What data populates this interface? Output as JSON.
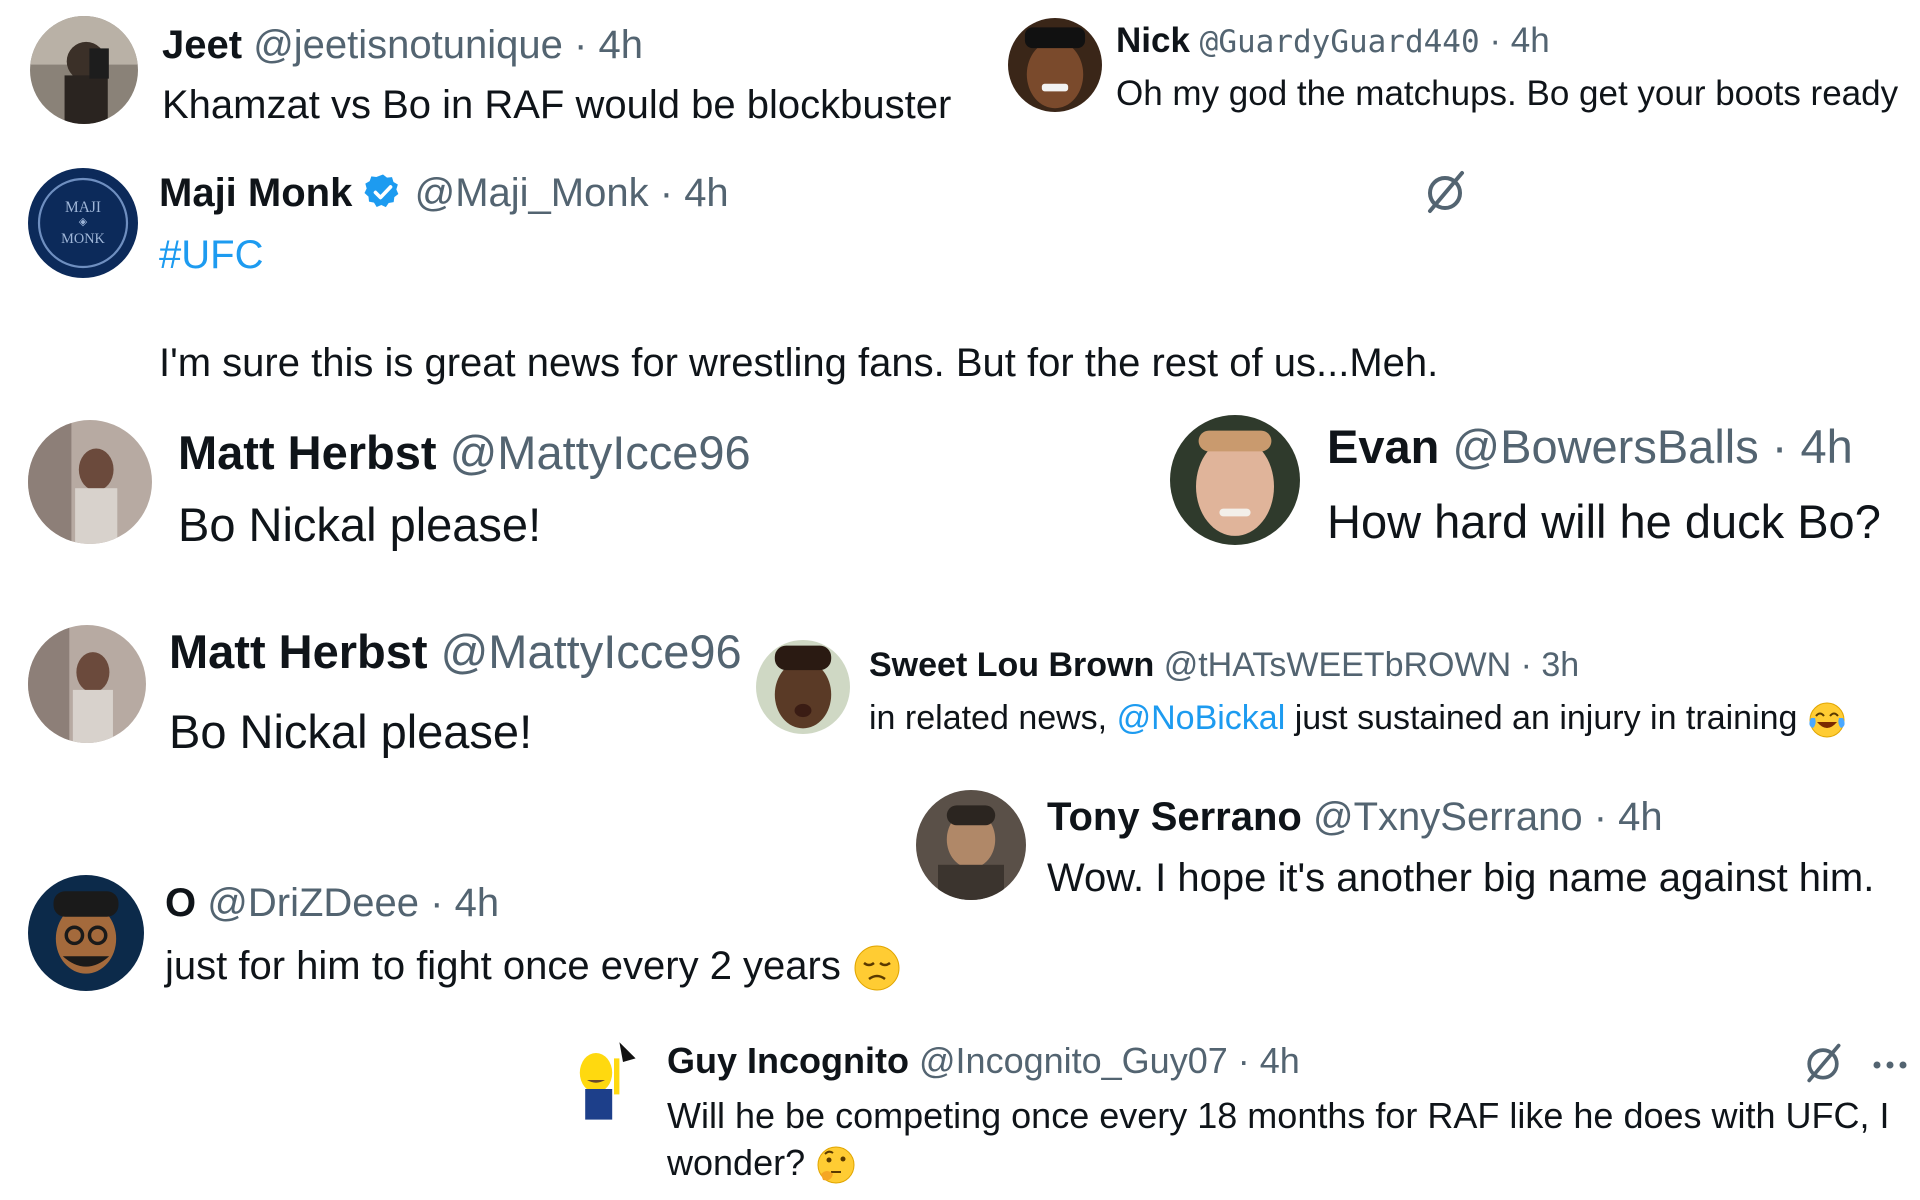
{
  "tweets": [
    {
      "name": "Jeet",
      "handle": "@jeetisnotunique",
      "sep": "·",
      "time": "4h",
      "text": "Khamzat vs Bo in RAF would be blockbuster",
      "avatar_icon": "user-photo-avatar"
    },
    {
      "name": "Nick",
      "handle": "@GuardyGuard440",
      "sep": "·",
      "time": "4h",
      "text": "Oh my god the matchups. Bo get your boots ready",
      "avatar_icon": "user-photo-avatar"
    },
    {
      "name": "Maji Monk",
      "handle": "@Maji_Monk",
      "sep": "·",
      "time": "4h",
      "hashtag": "#UFC",
      "text": "I'm sure this is great news for wrestling fans. But for the rest of us...Meh.",
      "avatar_icon": "maji-monk-logo",
      "verified_icon": "verified-badge-icon",
      "action_icon": "grok-icon"
    },
    {
      "name": "Matt Herbst",
      "handle": "@MattyIcce96",
      "text": "Bo Nickal please!",
      "avatar_icon": "user-photo-avatar"
    },
    {
      "name": "Evan",
      "handle": "@BowersBalls",
      "sep": "·",
      "time": "4h",
      "text": "How hard will he duck Bo?",
      "avatar_icon": "user-photo-avatar"
    },
    {
      "name": "Matt Herbst",
      "handle": "@MattyIcce96",
      "text": "Bo Nickal please!",
      "avatar_icon": "user-photo-avatar"
    },
    {
      "name": "Sweet Lou Brown",
      "handle": "@tHATsWEETbROWN",
      "sep": "·",
      "time": "3h",
      "text_before": "in related news, ",
      "mention": "@NoBickal",
      "text_after": " just sustained an injury in training",
      "emoji_icon": "tears-of-joy-emoji-icon",
      "avatar_icon": "user-photo-avatar"
    },
    {
      "name": "Tony Serrano",
      "handle": "@TxnySerrano",
      "sep": "·",
      "time": "4h",
      "text": "Wow. I hope it's another big name against him.",
      "avatar_icon": "user-photo-avatar"
    },
    {
      "name": "O",
      "handle": "@DriZDeee",
      "sep": "·",
      "time": "4h",
      "text": "just for him to fight once every 2 years",
      "emoji_icon": "disappointed-face-emoji-icon",
      "avatar_icon": "cartoon-avatar"
    },
    {
      "name": "Guy Incognito",
      "handle": "@Incognito_Guy07",
      "sep": "·",
      "time": "4h",
      "text_line1": "Will he be competing once every 18 months for RAF like he does with UFC, I",
      "text_line2": "wonder?",
      "emoji_icon": "thinking-face-emoji-icon",
      "avatar_icon": "cartoon-avatar",
      "action_icon": "grok-icon",
      "more_icon": "more-options-icon"
    }
  ],
  "colors": {
    "text": "#0f1419",
    "secondary": "#536471",
    "link": "#1d9bf0",
    "verified": "#1d9bf0"
  }
}
